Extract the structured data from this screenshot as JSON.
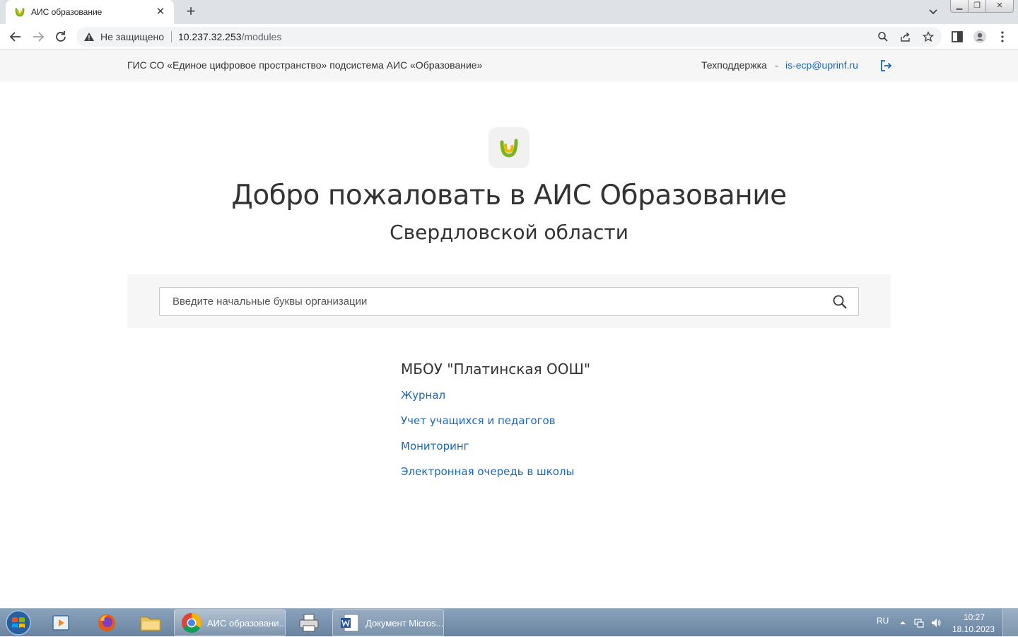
{
  "browser": {
    "tab_title": "АИС образование",
    "security_label": "Не защищено",
    "url_host": "10.237.32.253",
    "url_path": "/modules"
  },
  "header": {
    "site_title": "ГИС СО «Единое цифровое пространство» подсистема АИС «Образование»",
    "support_label": "Техподдержка",
    "support_separator": "-",
    "support_email": "is-ecp@uprinf.ru"
  },
  "hero": {
    "title": "Добро пожаловать в АИС Образование",
    "subtitle": "Свердловской области"
  },
  "search": {
    "placeholder": "Введите начальные буквы организации"
  },
  "organization": {
    "name": "МБОУ \"Платинская ООШ\"",
    "modules": [
      {
        "label": "Журнал"
      },
      {
        "label": "Учет учащихся и педагогов"
      },
      {
        "label": "Мониторинг"
      },
      {
        "label": "Электронная очередь в школы"
      }
    ]
  },
  "taskbar": {
    "tasks": [
      {
        "label": "АИС образовани..."
      },
      {
        "label": "Документ Micros..."
      }
    ],
    "language": "RU",
    "time": "10:27",
    "date": "18.10.2023"
  },
  "colors": {
    "link": "#1a66b8",
    "text": "#333333",
    "header_bg": "#f6f6f6",
    "logo_yellow": "#f0b400",
    "logo_green": "#7ab51d"
  }
}
